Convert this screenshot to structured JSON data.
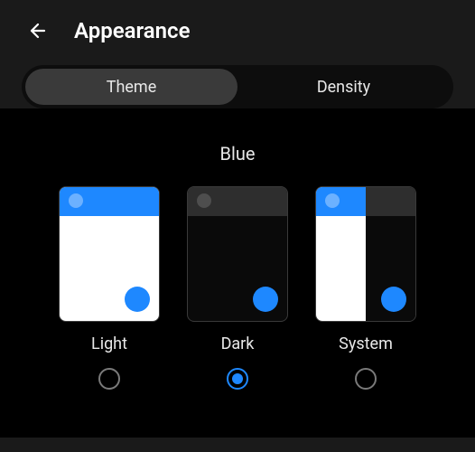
{
  "header": {
    "title": "Appearance"
  },
  "tabs": {
    "theme": "Theme",
    "density": "Density",
    "active": "theme"
  },
  "section": {
    "title": "Blue"
  },
  "options": {
    "light": {
      "label": "Light",
      "selected": false
    },
    "dark": {
      "label": "Dark",
      "selected": true
    },
    "system": {
      "label": "System",
      "selected": false
    }
  },
  "colors": {
    "accent": "#1e88ff"
  }
}
